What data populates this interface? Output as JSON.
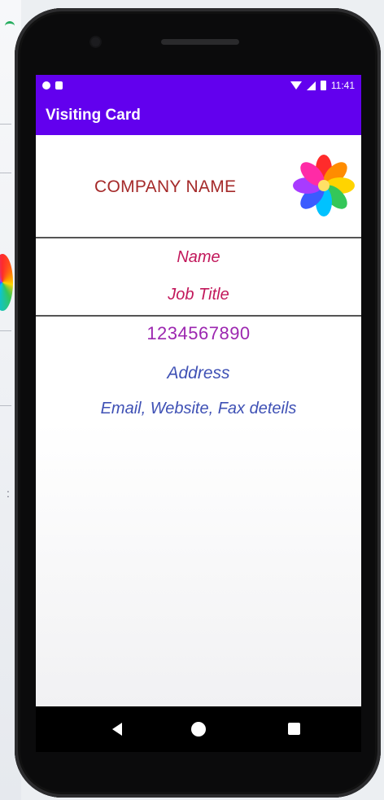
{
  "status_bar": {
    "time": "11:41",
    "icons": [
      "settings-circle-icon",
      "sd-card-icon",
      "wifi-icon",
      "signal-icon",
      "battery-icon"
    ],
    "background_color": "#6200ee"
  },
  "app_bar": {
    "title": "Visiting Card",
    "background_color": "#6200ee"
  },
  "card": {
    "company_name": "COMPANY NAME",
    "logo": "flower-logo-icon",
    "person_name": "Name",
    "job_title": "Job Title",
    "phone_number": "1234567890",
    "address": "Address",
    "contact_details": "Email, Website, Fax deteils",
    "colors": {
      "company_name": "#a52a2a",
      "person": "#c2185b",
      "phone": "#9c27b0",
      "contact": "#3f51b5"
    }
  },
  "nav_bar": {
    "icons": [
      "back-icon",
      "home-icon",
      "recents-icon"
    ]
  }
}
